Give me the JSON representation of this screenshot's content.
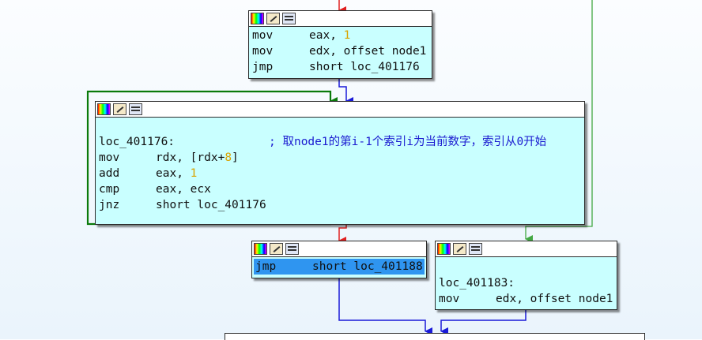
{
  "node_a": {
    "lines": [
      {
        "mnemonic": "mov",
        "operand_prefix": "eax, ",
        "operand_number": "1"
      },
      {
        "mnemonic": "mov",
        "operand_prefix": "edx, offset node1",
        "operand_number": ""
      },
      {
        "mnemonic": "jmp",
        "operand_prefix": "short loc_401176",
        "operand_number": ""
      }
    ]
  },
  "node_b": {
    "label": "loc_401176:",
    "comment": "; 取node1的第i-1个索引i为当前数字，索引从0开始",
    "lines": [
      {
        "mnemonic": "mov",
        "operand_prefix": "rdx, [rdx+",
        "operand_number": "8",
        "operand_suffix": "]"
      },
      {
        "mnemonic": "add",
        "operand_prefix": "eax, ",
        "operand_number": "1",
        "operand_suffix": ""
      },
      {
        "mnemonic": "cmp",
        "operand_prefix": "eax, ecx",
        "operand_number": "",
        "operand_suffix": ""
      },
      {
        "mnemonic": "jnz",
        "operand_prefix": "short loc_401176",
        "operand_number": "",
        "operand_suffix": ""
      }
    ]
  },
  "node_c": {
    "mnemonic": "jmp",
    "operand": "short loc_401188"
  },
  "node_d": {
    "label": "loc_401183:",
    "mnemonic": "mov",
    "operand": "edx, offset node1"
  },
  "colors": {
    "node_fill": "#c9ffff",
    "edge_true": "#1a1ad8",
    "edge_red": "#e02020",
    "edge_green": "#0a7a0a",
    "edge_light_green": "#43a843",
    "immediate_number": "#d9a300",
    "comment": "#1a1ad0",
    "selection": "#2f95f0"
  },
  "icons": [
    "color-palette-icon",
    "edit-node-icon",
    "graph-overview-icon"
  ]
}
